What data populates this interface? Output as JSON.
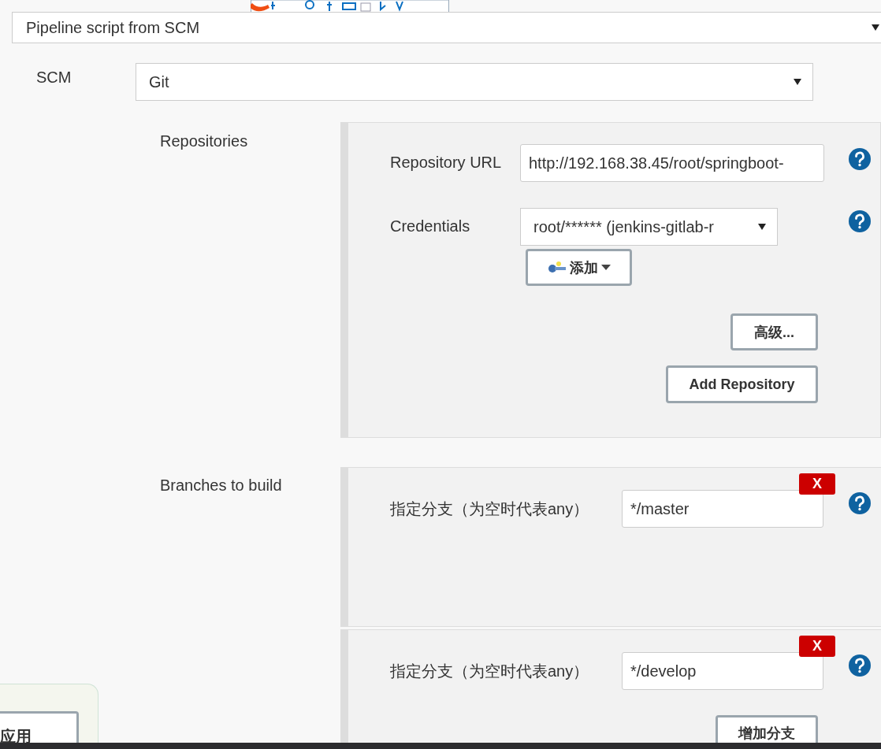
{
  "pipeline_definition": {
    "value": "Pipeline script from SCM"
  },
  "scm": {
    "label": "SCM",
    "value": "Git"
  },
  "repositories": {
    "label": "Repositories",
    "url": {
      "label": "Repository URL",
      "value": "http://192.168.38.45/root/springboot-"
    },
    "credentials": {
      "label": "Credentials",
      "value": "root/****** (jenkins-gitlab-r"
    },
    "add_button": "添加",
    "advanced_button": "高级...",
    "add_repository_button": "Add Repository"
  },
  "branches": {
    "label": "Branches to build",
    "items": [
      {
        "label": "指定分支（为空时代表any）",
        "value": "*/master",
        "delete": "X"
      },
      {
        "label": "指定分支（为空时代表any）",
        "value": "*/develop",
        "delete": "X"
      }
    ],
    "add_branch_button": "增加分支"
  },
  "apply_button": "应用"
}
